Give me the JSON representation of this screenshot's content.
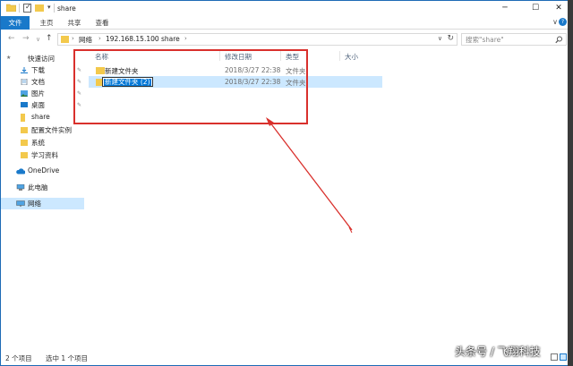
{
  "window": {
    "title": "share",
    "minimize_glyph": "─",
    "maximize_glyph": "☐",
    "close_glyph": "✕"
  },
  "quick_access_toolbar": {
    "dropdown_glyph": "▾"
  },
  "ribbon": {
    "tabs": [
      {
        "label": "文件",
        "active": true
      },
      {
        "label": "主页",
        "active": false
      },
      {
        "label": "共享",
        "active": false
      },
      {
        "label": "查看",
        "active": false
      }
    ],
    "expand_glyph": "∨",
    "help_glyph": "?"
  },
  "navigation": {
    "back_glyph": "←",
    "forward_glyph": "→",
    "recent_glyph": "∨",
    "up_glyph": "↑",
    "breadcrumb": [
      "网络",
      "192.168.15.100",
      "share"
    ],
    "crumb_separator": "›",
    "dropdown_glyph": "∨",
    "refresh_glyph": "↻"
  },
  "search": {
    "placeholder": "搜索\"share\"",
    "icon": "search-icon"
  },
  "nav_pane": {
    "quick_access": "快速访问",
    "pinned": [
      "下载",
      "文档",
      "图片",
      "桌面"
    ],
    "folders": [
      "share",
      "配置文件实例",
      "系统",
      "学习资料"
    ],
    "onedrive": "OneDrive",
    "this_pc": "此电脑",
    "network": "网络",
    "pin_glyph": "✎"
  },
  "file_list": {
    "columns": {
      "name": "名称",
      "modified": "修改日期",
      "type": "类型",
      "size": "大小"
    },
    "rows": [
      {
        "name": "新建文件夹",
        "modified": "2018/3/27 22:38",
        "type": "文件夹",
        "selected": false
      },
      {
        "name": "新建文件夹 (2)",
        "modified": "2018/3/27 22:38",
        "type": "文件夹",
        "selected": true,
        "renaming": true
      }
    ]
  },
  "status_bar": {
    "item_count": "2 个项目",
    "selection": "选中 1 个项目"
  },
  "colors": {
    "accent": "#1979ca",
    "selection_bg": "#cce8ff",
    "folder": "#f3c94c",
    "annotation": "#d9302c"
  },
  "watermark": "头条号 / 飞翔科技"
}
